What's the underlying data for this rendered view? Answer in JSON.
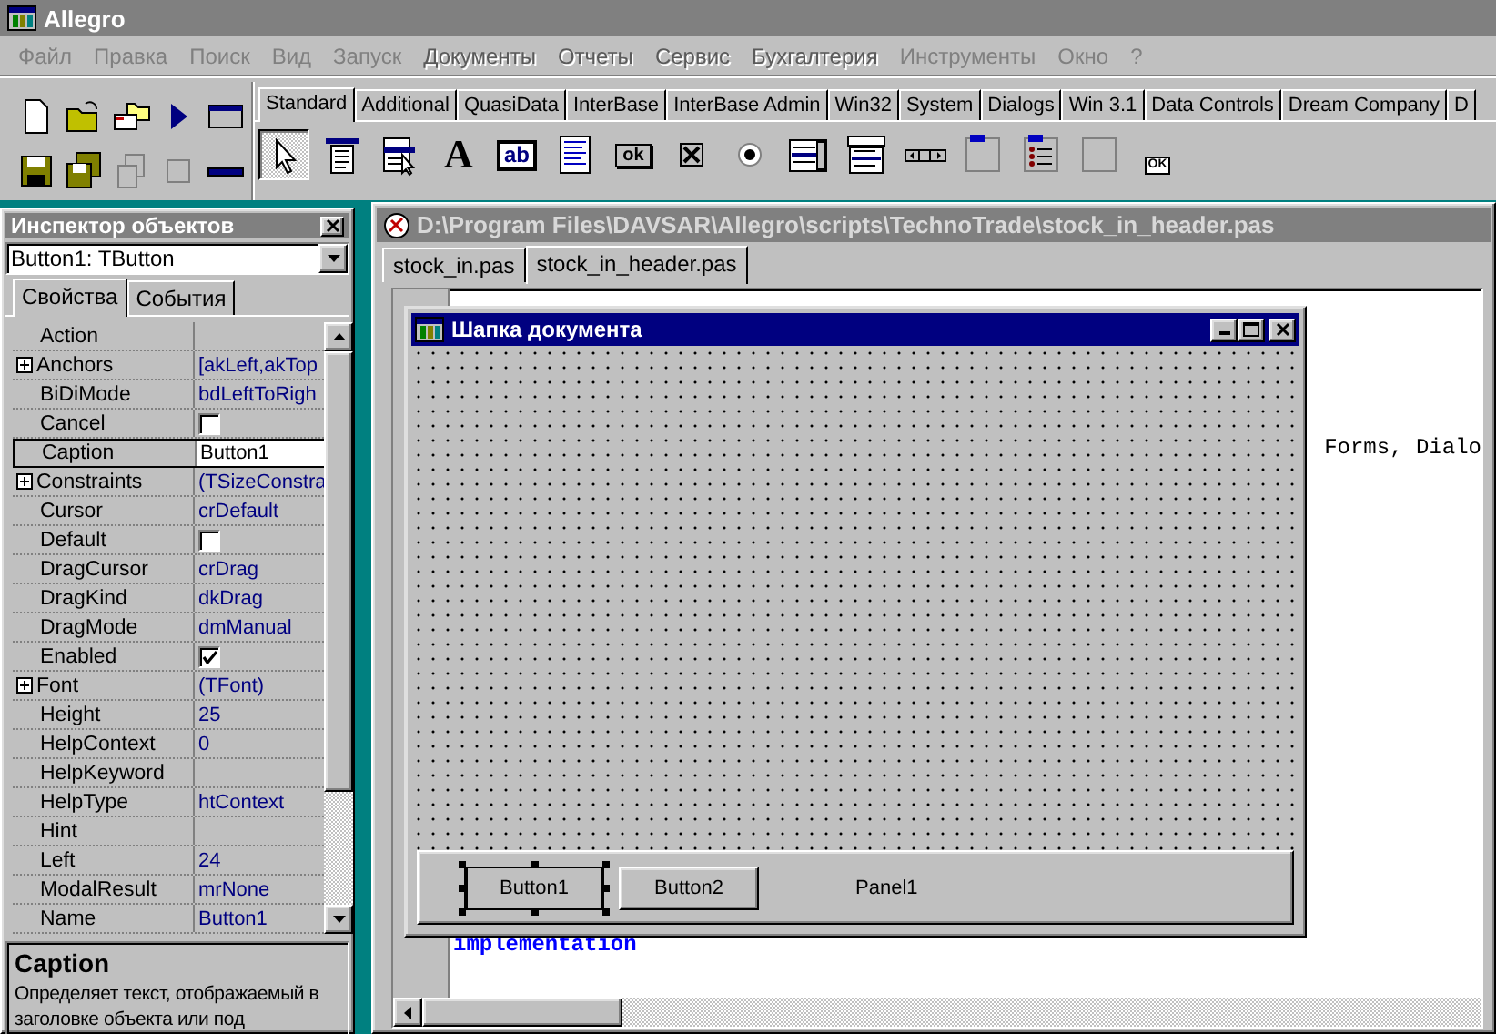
{
  "window": {
    "title": "Allegro"
  },
  "menu": [
    {
      "label": "Файл",
      "disabled": false
    },
    {
      "label": "Правка",
      "disabled": false
    },
    {
      "label": "Поиск",
      "disabled": false
    },
    {
      "label": "Вид",
      "disabled": false
    },
    {
      "label": "Запуск",
      "disabled": false
    },
    {
      "label": "Документы",
      "disabled": true
    },
    {
      "label": "Отчеты",
      "disabled": true
    },
    {
      "label": "Сервис",
      "disabled": true
    },
    {
      "label": "Бухгалтерия",
      "disabled": true
    },
    {
      "label": "Инструменты",
      "disabled": false
    },
    {
      "label": "Окно",
      "disabled": false
    },
    {
      "label": "?",
      "disabled": false
    }
  ],
  "palette_tabs": [
    {
      "label": "Standard",
      "selected": true
    },
    {
      "label": "Additional",
      "selected": false
    },
    {
      "label": "QuasiData",
      "selected": false
    },
    {
      "label": "InterBase",
      "selected": false
    },
    {
      "label": "InterBase Admin",
      "selected": false
    },
    {
      "label": "Win32",
      "selected": false
    },
    {
      "label": "System",
      "selected": false
    },
    {
      "label": "Dialogs",
      "selected": false
    },
    {
      "label": "Win 3.1",
      "selected": false
    },
    {
      "label": "Data Controls",
      "selected": false
    },
    {
      "label": "Dream Company",
      "selected": false
    },
    {
      "label": "D",
      "selected": false
    }
  ],
  "palette_items": [
    {
      "kind": "pointer",
      "selected": true
    },
    {
      "kind": "menu",
      "selected": false
    },
    {
      "kind": "popup",
      "selected": false
    },
    {
      "kind": "label",
      "glyph": "A",
      "selected": false
    },
    {
      "kind": "edit",
      "glyph": "ab",
      "selected": false
    },
    {
      "kind": "memo",
      "selected": false
    },
    {
      "kind": "button",
      "glyph": "ok",
      "selected": false
    },
    {
      "kind": "checkbox",
      "selected": false
    },
    {
      "kind": "radio",
      "selected": false
    },
    {
      "kind": "listbox",
      "selected": false
    },
    {
      "kind": "combobox",
      "selected": false
    },
    {
      "kind": "scrollbar",
      "selected": false
    },
    {
      "kind": "groupbox",
      "selected": false
    },
    {
      "kind": "radiogroup",
      "selected": false
    },
    {
      "kind": "panel",
      "selected": false
    },
    {
      "kind": "actionlist",
      "glyph": "OK",
      "selected": false
    }
  ],
  "inspector": {
    "title": "Инспектор объектов",
    "object": "Button1: TButton",
    "tabs": [
      {
        "label": "Свойства",
        "selected": true
      },
      {
        "label": "События",
        "selected": false
      }
    ],
    "properties": [
      {
        "name": "Action",
        "kind": "text",
        "expandable": false,
        "selected": false
      },
      {
        "name": "Anchors",
        "value": "[akLeft,akTop",
        "kind": "text",
        "expandable": true,
        "selected": false
      },
      {
        "name": "BiDiMode",
        "value": "bdLeftToRigh",
        "kind": "text",
        "expandable": false,
        "selected": false
      },
      {
        "name": "Cancel",
        "kind": "check",
        "checked": false,
        "expandable": false,
        "selected": false
      },
      {
        "name": "Caption",
        "value": "Button1",
        "kind": "text",
        "expandable": false,
        "selected": true
      },
      {
        "name": "Constraints",
        "value": "(TSizeConstra",
        "kind": "text",
        "expandable": true,
        "selected": false
      },
      {
        "name": "Cursor",
        "value": "crDefault",
        "kind": "text",
        "expandable": false,
        "selected": false
      },
      {
        "name": "Default",
        "kind": "check",
        "checked": false,
        "expandable": false,
        "selected": false
      },
      {
        "name": "DragCursor",
        "value": "crDrag",
        "kind": "text",
        "expandable": false,
        "selected": false
      },
      {
        "name": "DragKind",
        "value": "dkDrag",
        "kind": "text",
        "expandable": false,
        "selected": false
      },
      {
        "name": "DragMode",
        "value": "dmManual",
        "kind": "text",
        "expandable": false,
        "selected": false
      },
      {
        "name": "Enabled",
        "kind": "check",
        "checked": true,
        "expandable": false,
        "selected": false
      },
      {
        "name": "Font",
        "value": "(TFont)",
        "kind": "text",
        "expandable": true,
        "selected": false
      },
      {
        "name": "Height",
        "value": "25",
        "kind": "text",
        "expandable": false,
        "selected": false
      },
      {
        "name": "HelpContext",
        "value": "0",
        "kind": "text",
        "expandable": false,
        "selected": false
      },
      {
        "name": "HelpKeyword",
        "kind": "text",
        "expandable": false,
        "selected": false
      },
      {
        "name": "HelpType",
        "value": "htContext",
        "kind": "text",
        "expandable": false,
        "selected": false
      },
      {
        "name": "Hint",
        "kind": "text",
        "expandable": false,
        "selected": false
      },
      {
        "name": "Left",
        "value": "24",
        "kind": "text",
        "expandable": false,
        "selected": false
      },
      {
        "name": "ModalResult",
        "value": "mrNone",
        "kind": "text",
        "expandable": false,
        "selected": false
      },
      {
        "name": "Name",
        "value": "Button1",
        "kind": "text",
        "expandable": false,
        "selected": false
      }
    ],
    "description": {
      "title": "Caption",
      "text": "Определяет текст, отображаемый в заголовке объекта или под"
    }
  },
  "editor": {
    "title": "D:\\Program Files\\DAVSAR\\Allegro\\scripts\\TechnoTrade\\stock_in_header.pas",
    "tabs": [
      {
        "label": "stock_in.pas",
        "selected": false
      },
      {
        "label": "stock_in_header.pas",
        "selected": true
      }
    ],
    "code_lines": [
      {
        "text": "Forms, Dialo",
        "kind": "plain"
      },
      {
        "text": "implementation",
        "kind": "keyword"
      }
    ]
  },
  "form": {
    "title": "Шапка документа",
    "buttons": [
      {
        "label": "Button1",
        "selected": true
      },
      {
        "label": "Button2",
        "selected": false
      }
    ],
    "panel_caption": "Panel1"
  }
}
